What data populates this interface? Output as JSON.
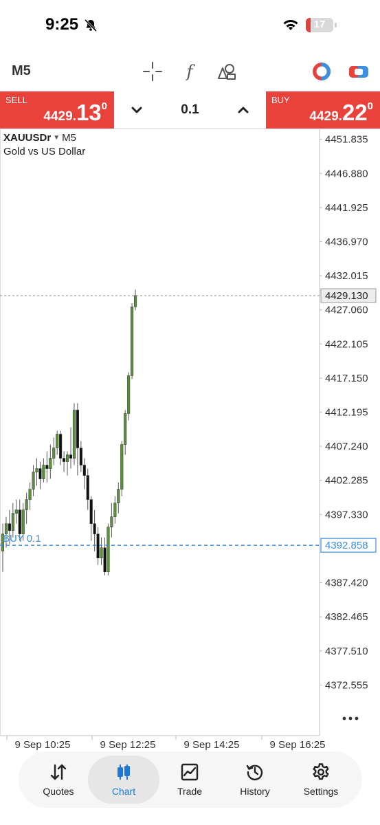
{
  "status_bar": {
    "time": "9:25",
    "battery": "17",
    "icons": [
      "bell-slash-icon",
      "wifi-icon",
      "battery-icon"
    ]
  },
  "toolbar": {
    "timeframe": "M5",
    "tools": [
      "crosshair-icon",
      "indicator-f-icon",
      "objects-icon",
      "one-click-trading-icon",
      "account-toggle-icon"
    ]
  },
  "trade_panel": {
    "sell": {
      "label": "SELL",
      "price_small": "4429.",
      "price_big": "13",
      "price_sup": "0"
    },
    "buy": {
      "label": "BUY",
      "price_small": "4429.",
      "price_big": "22",
      "price_sup": "0"
    },
    "lot": "0.1"
  },
  "chart": {
    "symbol": "XAUUSDr",
    "timeframe": "M5",
    "description": "Gold vs US Dollar",
    "current_price_label": "4429.130",
    "order_line": {
      "label": "BUY 0.1",
      "price": 4392.858,
      "price_label": "4392.858"
    },
    "colors": {
      "up": "#5c8f3f",
      "down": "#111111",
      "order": "#3d8fe0",
      "bid_line": "#888888"
    }
  },
  "chart_data": {
    "type": "candlestick",
    "symbol": "XAUUSDr",
    "timeframe": "M5",
    "ylim": [
      4368.6,
      4452.5
    ],
    "y_ticks": [
      "4451.835",
      "4446.880",
      "4441.925",
      "4436.970",
      "4432.015",
      "4427.060",
      "4422.105",
      "4417.150",
      "4412.195",
      "4407.240",
      "4402.285",
      "4397.330",
      "4387.420",
      "4382.465",
      "4377.510",
      "4372.555"
    ],
    "x_ticks": [
      "9 Sep 10:25",
      "9 Sep 12:25",
      "9 Sep 14:25",
      "9 Sep 16:25"
    ],
    "current_price": 4429.13,
    "order_price": 4392.858,
    "candles": [
      [
        4392.0,
        4394.5,
        4389.0,
        4396.0
      ],
      [
        4394.5,
        4396.0,
        4392.5,
        4397.0
      ],
      [
        4396.0,
        4395.0,
        4393.0,
        4398.0
      ],
      [
        4395.0,
        4397.5,
        4394.0,
        4399.0
      ],
      [
        4397.5,
        4398.0,
        4396.0,
        4399.5
      ],
      [
        4398.0,
        4394.5,
        4393.5,
        4399.5
      ],
      [
        4394.5,
        4398.0,
        4393.5,
        4399.0
      ],
      [
        4398.0,
        4399.5,
        4396.0,
        4400.5
      ],
      [
        4399.5,
        4401.0,
        4398.0,
        4402.0
      ],
      [
        4401.0,
        4403.5,
        4400.0,
        4404.5
      ],
      [
        4403.5,
        4404.0,
        4401.5,
        4405.5
      ],
      [
        4404.0,
        4402.5,
        4401.0,
        4405.0
      ],
      [
        4402.5,
        4404.5,
        4402.0,
        4405.5
      ],
      [
        4404.5,
        4404.0,
        4402.0,
        4406.5
      ],
      [
        4404.0,
        4405.5,
        4402.5,
        4407.5
      ],
      [
        4405.5,
        4407.0,
        4404.5,
        4408.5
      ],
      [
        4407.0,
        4409.0,
        4406.0,
        4409.5
      ],
      [
        4409.0,
        4405.5,
        4404.5,
        4409.5
      ],
      [
        4405.5,
        4405.0,
        4403.5,
        4406.5
      ],
      [
        4405.0,
        4406.0,
        4403.0,
        4406.5
      ],
      [
        4406.0,
        4405.5,
        4404.0,
        4410.0
      ],
      [
        4405.5,
        4412.5,
        4404.5,
        4413.5
      ],
      [
        4412.5,
        4407.0,
        4403.0,
        4413.5
      ],
      [
        4407.0,
        4404.5,
        4403.5,
        4408.0
      ],
      [
        4404.5,
        4403.0,
        4401.0,
        4405.5
      ],
      [
        4403.0,
        4399.5,
        4398.0,
        4404.0
      ],
      [
        4399.5,
        4396.0,
        4393.5,
        4400.0
      ],
      [
        4396.0,
        4394.5,
        4392.0,
        4398.0
      ],
      [
        4394.5,
        4391.0,
        4390.0,
        4395.5
      ],
      [
        4391.0,
        4392.5,
        4390.0,
        4394.0
      ],
      [
        4392.5,
        4389.0,
        4388.5,
        4394.0
      ],
      [
        4389.0,
        4395.5,
        4388.5,
        4396.0
      ],
      [
        4395.5,
        4397.0,
        4394.0,
        4399.0
      ],
      [
        4397.0,
        4399.0,
        4396.0,
        4400.0
      ],
      [
        4399.0,
        4401.0,
        4397.5,
        4402.0
      ],
      [
        4401.0,
        4407.5,
        4400.0,
        4408.0
      ],
      [
        4407.5,
        4412.0,
        4406.0,
        4412.5
      ],
      [
        4412.0,
        4417.5,
        4411.0,
        4418.0
      ],
      [
        4417.5,
        4427.5,
        4417.0,
        4428.0
      ],
      [
        4427.5,
        4429.13,
        4427.0,
        4430.0
      ]
    ]
  },
  "nav": {
    "items": [
      {
        "label": "Quotes",
        "icon": "quotes-arrows-icon",
        "active": false
      },
      {
        "label": "Chart",
        "icon": "candles-icon",
        "active": true
      },
      {
        "label": "Trade",
        "icon": "trade-chart-icon",
        "active": false
      },
      {
        "label": "History",
        "icon": "history-clock-icon",
        "active": false
      },
      {
        "label": "Settings",
        "icon": "settings-gear-icon",
        "active": false
      }
    ]
  }
}
